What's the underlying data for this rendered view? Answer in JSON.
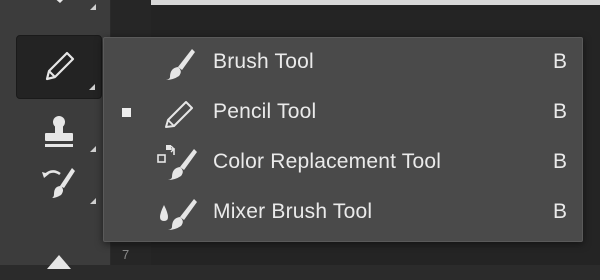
{
  "toolbar": {
    "tools": [
      {
        "name": "fill-tool",
        "icon": "paint-bucket-icon"
      },
      {
        "name": "pencil-tool",
        "icon": "pencil-icon",
        "active": true
      },
      {
        "name": "stamp-tool",
        "icon": "clone-stamp-icon"
      },
      {
        "name": "history-brush-tool",
        "icon": "history-brush-icon"
      },
      {
        "name": "shape-tool",
        "icon": "arrow-up-icon"
      }
    ]
  },
  "ruler": {
    "number": "7"
  },
  "flyout": {
    "items": [
      {
        "label": "Brush Tool",
        "shortcut": "B",
        "icon": "brush-icon",
        "selected": false
      },
      {
        "label": "Pencil Tool",
        "shortcut": "B",
        "icon": "pencil-icon",
        "selected": true
      },
      {
        "label": "Color Replacement Tool",
        "shortcut": "B",
        "icon": "color-replacement-icon",
        "selected": false
      },
      {
        "label": "Mixer Brush Tool",
        "shortcut": "B",
        "icon": "mixer-brush-icon",
        "selected": false
      }
    ]
  },
  "colors": {
    "menu_bg": "#4a4a4a",
    "toolbar_bg": "#3c3c3c",
    "text": "#eaeaea"
  }
}
